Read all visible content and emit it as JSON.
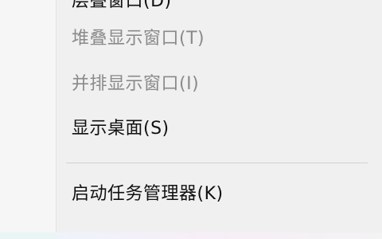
{
  "context_menu": {
    "items": [
      {
        "label": "层叠窗口(D)",
        "enabled": true
      },
      {
        "label": "堆叠显示窗口(T)",
        "enabled": false
      },
      {
        "label": "并排显示窗口(I)",
        "enabled": false
      },
      {
        "label": "显示桌面(S)",
        "enabled": true
      },
      {
        "label": "启动任务管理器(K)",
        "enabled": true
      }
    ]
  }
}
